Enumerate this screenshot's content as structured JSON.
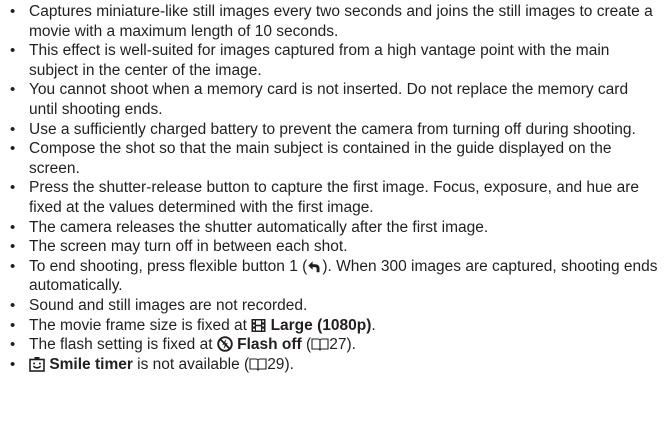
{
  "bullets": [
    {
      "text": "Captures miniature-like still images every two seconds and joins the still images to create a movie with a maximum length of 10 seconds."
    },
    {
      "text": "This effect is well-suited for images captured from a high vantage point with the main subject in the center of the image."
    },
    {
      "text": "You cannot shoot when a memory card is not inserted. Do not replace the memory card until shooting ends."
    },
    {
      "text": "Use a sufficiently charged battery to prevent the camera from turning off during shooting."
    },
    {
      "text": "Compose the shot so that the main subject is contained in the guide displayed on the screen."
    },
    {
      "text": "Press the shutter-release button to capture the first image. Focus, exposure, and hue are fixed at the values determined with the first image."
    },
    {
      "text": "The camera releases the shutter automatically after the first image."
    },
    {
      "text": "The screen may turn off in between each shot."
    },
    {
      "pre": "To end shooting, press flexible button 1 (",
      "post": "). When 300 images are captured, shooting ends automatically.",
      "icon": "return-arrow-icon"
    },
    {
      "text": "Sound and still images are not recorded."
    },
    {
      "pre": "The movie frame size is fixed at ",
      "bold": "Large (1080p)",
      "post": ".",
      "icon": "film-strip-icon"
    },
    {
      "pre": "The flash setting is fixed at ",
      "bold": "Flash off",
      "post": " (",
      "ref": "27",
      "tail": ").",
      "icon": "flash-off-icon"
    },
    {
      "bold": "Smile timer",
      "post": " is not available (",
      "ref": "29",
      "tail": ").",
      "icon": "smile-timer-icon"
    }
  ],
  "icons": {
    "return": "return-arrow-icon",
    "film": "film-strip-icon",
    "flash_off": "flash-off-icon",
    "smile_timer": "smile-timer-icon",
    "book": "book-reference-icon"
  }
}
